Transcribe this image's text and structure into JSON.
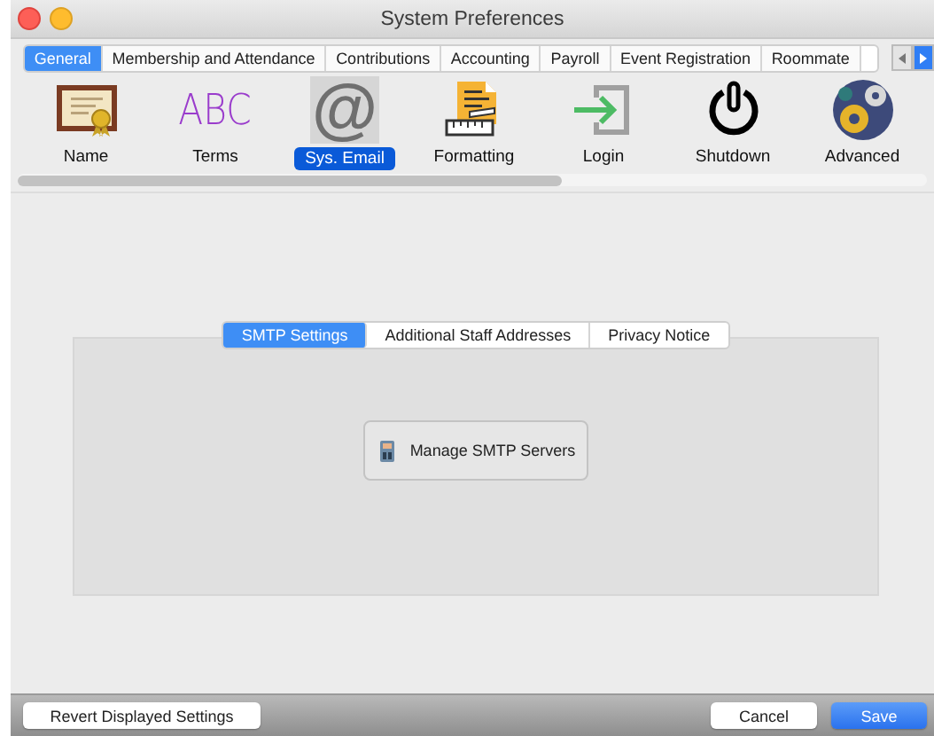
{
  "window": {
    "title": "System Preferences"
  },
  "tabs": [
    {
      "label": "General",
      "selected": true
    },
    {
      "label": "Membership and Attendance",
      "selected": false
    },
    {
      "label": "Contributions",
      "selected": false
    },
    {
      "label": "Accounting",
      "selected": false
    },
    {
      "label": "Payroll",
      "selected": false
    },
    {
      "label": "Event Registration",
      "selected": false
    },
    {
      "label": "Roommate",
      "selected": false
    }
  ],
  "toolbar": [
    {
      "label": "Name",
      "kind": "certificate",
      "selected": false
    },
    {
      "label": "Terms",
      "kind": "glyph",
      "glyph": "ABC",
      "color": "#9a3ccc",
      "selected": false
    },
    {
      "label": "Sys. Email",
      "kind": "glyph",
      "glyph": "@",
      "color": "#6f6f6f",
      "selected": true
    },
    {
      "label": "Formatting",
      "kind": "document",
      "selected": false
    },
    {
      "label": "Login",
      "kind": "login",
      "selected": false
    },
    {
      "label": "Shutdown",
      "kind": "power",
      "selected": false
    },
    {
      "label": "Advanced",
      "kind": "gears",
      "selected": false
    }
  ],
  "subtabs": [
    {
      "label": "SMTP Settings",
      "selected": true
    },
    {
      "label": "Additional Staff Addresses",
      "selected": false
    },
    {
      "label": "Privacy Notice",
      "selected": false
    }
  ],
  "panel": {
    "button": "Manage SMTP Servers"
  },
  "footer": {
    "revert": "Revert Displayed Settings",
    "cancel": "Cancel",
    "save": "Save"
  }
}
